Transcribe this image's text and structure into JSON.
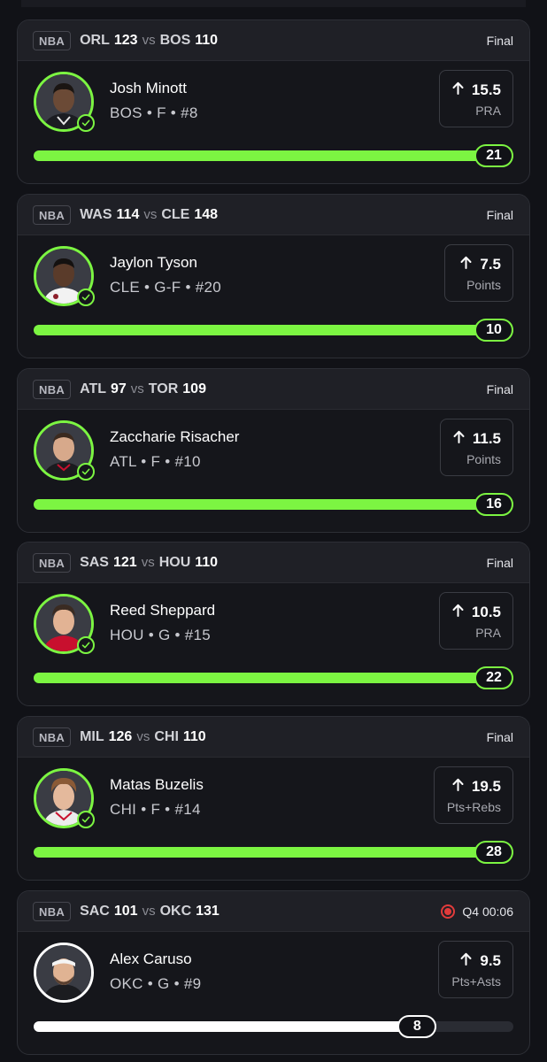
{
  "cards": [
    {
      "league": "NBA",
      "away_team": "ORL",
      "away_score": "123",
      "vs": "vs",
      "home_team": "BOS",
      "home_score": "110",
      "status": "Final",
      "live": false,
      "player_name": "Josh Minott",
      "player_info": "BOS • F • #8",
      "line_value": "15.5",
      "line_stat": "PRA",
      "actual": "21",
      "progress": 1.0,
      "hit": true
    },
    {
      "league": "NBA",
      "away_team": "WAS",
      "away_score": "114",
      "vs": "vs",
      "home_team": "CLE",
      "home_score": "148",
      "status": "Final",
      "live": false,
      "player_name": "Jaylon Tyson",
      "player_info": "CLE • G-F • #20",
      "line_value": "7.5",
      "line_stat": "Points",
      "actual": "10",
      "progress": 1.0,
      "hit": true
    },
    {
      "league": "NBA",
      "away_team": "ATL",
      "away_score": "97",
      "vs": "vs",
      "home_team": "TOR",
      "home_score": "109",
      "status": "Final",
      "live": false,
      "player_name": "Zaccharie Risacher",
      "player_info": "ATL • F • #10",
      "line_value": "11.5",
      "line_stat": "Points",
      "actual": "16",
      "progress": 1.0,
      "hit": true
    },
    {
      "league": "NBA",
      "away_team": "SAS",
      "away_score": "121",
      "vs": "vs",
      "home_team": "HOU",
      "home_score": "110",
      "status": "Final",
      "live": false,
      "player_name": "Reed Sheppard",
      "player_info": "HOU • G • #15",
      "line_value": "10.5",
      "line_stat": "PRA",
      "actual": "22",
      "progress": 1.0,
      "hit": true
    },
    {
      "league": "NBA",
      "away_team": "MIL",
      "away_score": "126",
      "vs": "vs",
      "home_team": "CHI",
      "home_score": "110",
      "status": "Final",
      "live": false,
      "player_name": "Matas Buzelis",
      "player_info": "CHI • F • #14",
      "line_value": "19.5",
      "line_stat": "Pts+Rebs",
      "actual": "28",
      "progress": 1.0,
      "hit": true
    },
    {
      "league": "NBA",
      "away_team": "SAC",
      "away_score": "101",
      "vs": "vs",
      "home_team": "OKC",
      "home_score": "131",
      "status": "Q4 00:06",
      "live": true,
      "player_name": "Alex Caruso",
      "player_info": "OKC • G • #9",
      "line_value": "9.5",
      "line_stat": "Pts+Asts",
      "actual": "8",
      "progress": 0.84,
      "hit": false
    }
  ],
  "colors": {
    "accent_green": "#7cf542",
    "live_red": "#e13b3b",
    "background": "#111217",
    "card": "#15161b"
  },
  "icons": {
    "direction": "arrow-up-icon",
    "hit": "check-circle-icon",
    "live": "live-record-icon"
  }
}
